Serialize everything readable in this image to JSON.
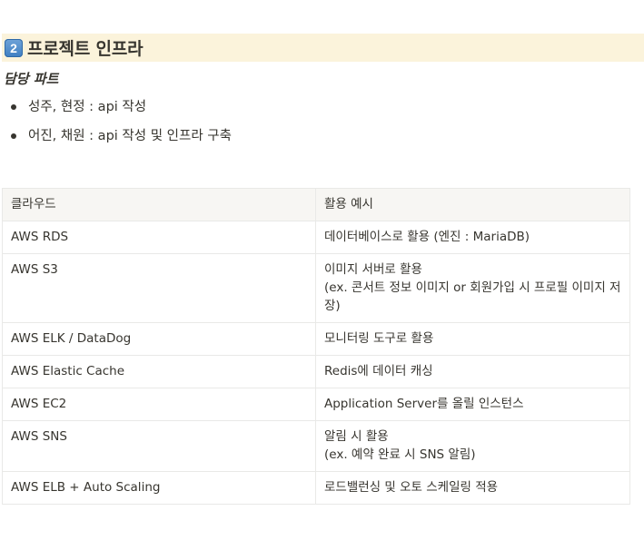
{
  "heading": {
    "keycap": "2",
    "title": "프로젝트 인프라"
  },
  "subheading": "담당 파트",
  "bullets": [
    "성주, 현정 : api 작성",
    "어진, 채원 : api 작성 및 인프라 구축"
  ],
  "table": {
    "headers": [
      "클라우드",
      "활용 예시"
    ],
    "rows": [
      {
        "cloud": "AWS RDS",
        "usage": [
          "데이터베이스로 활용 (엔진 : MariaDB)"
        ]
      },
      {
        "cloud": "AWS S3",
        "usage": [
          "이미지 서버로 활용",
          "(ex. 콘서트 정보 이미지 or 회원가입 시 프로필 이미지 저",
          "장)"
        ]
      },
      {
        "cloud": "AWS ELK / DataDog",
        "usage": [
          "모니터링 도구로 활용"
        ]
      },
      {
        "cloud": "AWS Elastic Cache",
        "usage": [
          "Redis에 데이터 캐싱"
        ]
      },
      {
        "cloud": "AWS EC2",
        "usage": [
          "Application Server를 올릴 인스턴스"
        ]
      },
      {
        "cloud": "AWS SNS",
        "usage": [
          "알림 시 활용",
          "(ex. 예약 완료 시 SNS 알림)"
        ]
      },
      {
        "cloud": "AWS ELB + Auto Scaling",
        "usage": [
          "로드밸런싱 및 오토 스케일링 적용"
        ]
      }
    ]
  }
}
